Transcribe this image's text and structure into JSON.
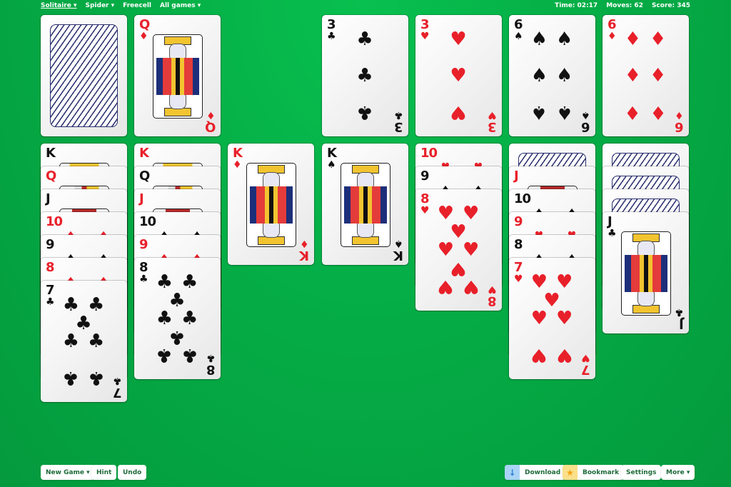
{
  "nav": {
    "items": [
      {
        "label": "Solitaire ▾",
        "active": true
      },
      {
        "label": "Spider ▾",
        "active": false
      },
      {
        "label": "Freecell",
        "active": false
      },
      {
        "label": "All games ▾",
        "active": false
      }
    ]
  },
  "stats": {
    "time": "Time: 02:17",
    "moves": "Moves: 62",
    "score": "Score: 345"
  },
  "stock": {
    "state": "face-down"
  },
  "waste": {
    "rank": "Q",
    "suit": "♦",
    "color": "red"
  },
  "foundations": [
    {
      "rank": "3",
      "suit": "♣",
      "color": "black"
    },
    {
      "rank": "3",
      "suit": "♥",
      "color": "red"
    },
    {
      "rank": "6",
      "suit": "♠",
      "color": "black"
    },
    {
      "rank": "6",
      "suit": "♦",
      "color": "red"
    }
  ],
  "tableau": [
    {
      "cards": [
        {
          "rank": "K",
          "color": "black",
          "facedown": false
        },
        {
          "rank": "Q",
          "color": "red",
          "facedown": false
        },
        {
          "rank": "J",
          "color": "black",
          "facedown": false
        },
        {
          "rank": "10",
          "color": "red",
          "suit": "♦",
          "facedown": false
        },
        {
          "rank": "9",
          "color": "black",
          "facedown": false
        },
        {
          "rank": "8",
          "color": "red",
          "suit": "♦",
          "facedown": false
        },
        {
          "rank": "7",
          "suit": "♣",
          "color": "black",
          "facedown": false
        }
      ]
    },
    {
      "cards": [
        {
          "rank": "K",
          "color": "red",
          "facedown": false
        },
        {
          "rank": "Q",
          "color": "black",
          "facedown": false
        },
        {
          "rank": "J",
          "color": "red",
          "facedown": false
        },
        {
          "rank": "10",
          "color": "black",
          "suit": "♠",
          "facedown": false
        },
        {
          "rank": "9",
          "color": "red",
          "suit": "♦",
          "facedown": false
        },
        {
          "rank": "8",
          "suit": "♣",
          "color": "black",
          "facedown": false
        }
      ]
    },
    {
      "cards": [
        {
          "rank": "K",
          "suit": "♦",
          "color": "red",
          "facedown": false
        }
      ]
    },
    {
      "cards": [
        {
          "rank": "K",
          "suit": "♠",
          "color": "black",
          "facedown": false
        }
      ]
    },
    {
      "cards": [
        {
          "rank": "10",
          "color": "red",
          "suit": "♥",
          "facedown": false
        },
        {
          "rank": "9",
          "color": "black",
          "suit": "♠",
          "facedown": false
        },
        {
          "rank": "8",
          "suit": "♥",
          "color": "red",
          "facedown": false
        }
      ]
    },
    {
      "cards": [
        {
          "facedown": true
        },
        {
          "rank": "J",
          "color": "red",
          "facedown": false
        },
        {
          "rank": "10",
          "color": "black",
          "facedown": false
        },
        {
          "rank": "9",
          "color": "red",
          "suit": "♥",
          "facedown": false
        },
        {
          "rank": "8",
          "color": "black",
          "facedown": false
        },
        {
          "rank": "7",
          "suit": "♥",
          "color": "red",
          "facedown": false
        }
      ]
    },
    {
      "cards": [
        {
          "facedown": true
        },
        {
          "facedown": true
        },
        {
          "facedown": true
        },
        {
          "rank": "J",
          "suit": "♣",
          "color": "black",
          "facedown": false
        }
      ]
    }
  ],
  "buttons": {
    "new_game": "New Game ▾",
    "hint": "Hint",
    "undo": "Undo",
    "download": "Download",
    "bookmark": "Bookmark",
    "settings": "Settings",
    "more": "More ▾"
  },
  "icons": {
    "download": "↓",
    "bookmark": "★"
  },
  "colors": {
    "felt": "#05ad46",
    "red_suit": "#e8202a",
    "black_suit": "#111111",
    "card_back_lines": "#2a2f6e",
    "button_text": "#1e6b3a"
  }
}
